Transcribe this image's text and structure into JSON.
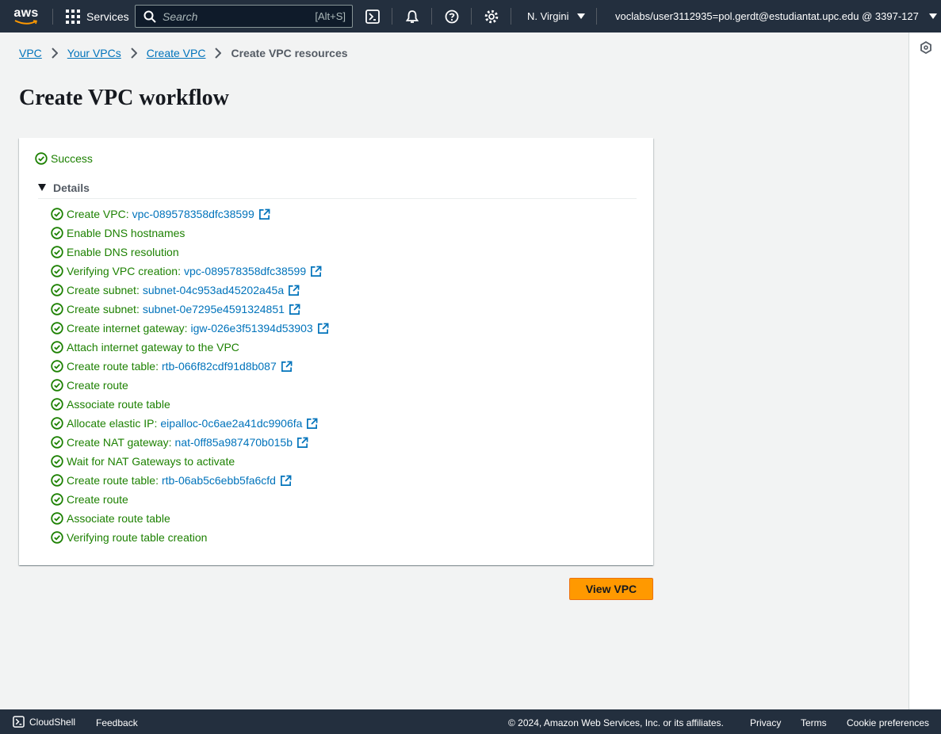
{
  "nav": {
    "logo_text": "aws",
    "services_label": "Services",
    "search_placeholder": "Search",
    "search_shortcut": "[Alt+S]",
    "region": "N. Virgini",
    "account": "voclabs/user3112935=pol.gerdt@estudiantat.upc.edu @ 3397-127"
  },
  "breadcrumb": {
    "items": [
      "VPC",
      "Your VPCs",
      "Create VPC"
    ],
    "current": "Create VPC resources"
  },
  "page_title": "Create VPC workflow",
  "status": "Success",
  "details_label": "Details",
  "steps": [
    {
      "label": "Create VPC:",
      "link": "vpc-089578358dfc38599"
    },
    {
      "label": "Enable DNS hostnames",
      "link": null
    },
    {
      "label": "Enable DNS resolution",
      "link": null
    },
    {
      "label": "Verifying VPC creation:",
      "link": "vpc-089578358dfc38599"
    },
    {
      "label": "Create subnet:",
      "link": "subnet-04c953ad45202a45a"
    },
    {
      "label": "Create subnet:",
      "link": "subnet-0e7295e4591324851"
    },
    {
      "label": "Create internet gateway:",
      "link": "igw-026e3f51394d53903"
    },
    {
      "label": "Attach internet gateway to the VPC",
      "link": null
    },
    {
      "label": "Create route table:",
      "link": "rtb-066f82cdf91d8b087"
    },
    {
      "label": "Create route",
      "link": null
    },
    {
      "label": "Associate route table",
      "link": null
    },
    {
      "label": "Allocate elastic IP:",
      "link": "eipalloc-0c6ae2a41dc9906fa"
    },
    {
      "label": "Create NAT gateway:",
      "link": "nat-0ff85a987470b015b"
    },
    {
      "label": "Wait for NAT Gateways to activate",
      "link": null
    },
    {
      "label": "Create route table:",
      "link": "rtb-06ab5c6ebb5fa6cfd"
    },
    {
      "label": "Create route",
      "link": null
    },
    {
      "label": "Associate route table",
      "link": null
    },
    {
      "label": "Verifying route table creation",
      "link": null
    }
  ],
  "view_button": "View VPC",
  "footer": {
    "cloudshell": "CloudShell",
    "feedback": "Feedback",
    "copyright": "© 2024, Amazon Web Services, Inc. or its affiliates.",
    "privacy": "Privacy",
    "terms": "Terms",
    "cookies": "Cookie preferences"
  },
  "colors": {
    "nav_bg": "#232f3e",
    "success": "#1d8102",
    "link": "#0073bb",
    "primary_button": "#ff9900"
  },
  "icons": {
    "status": "check-circle-icon",
    "external": "external-link-icon"
  }
}
